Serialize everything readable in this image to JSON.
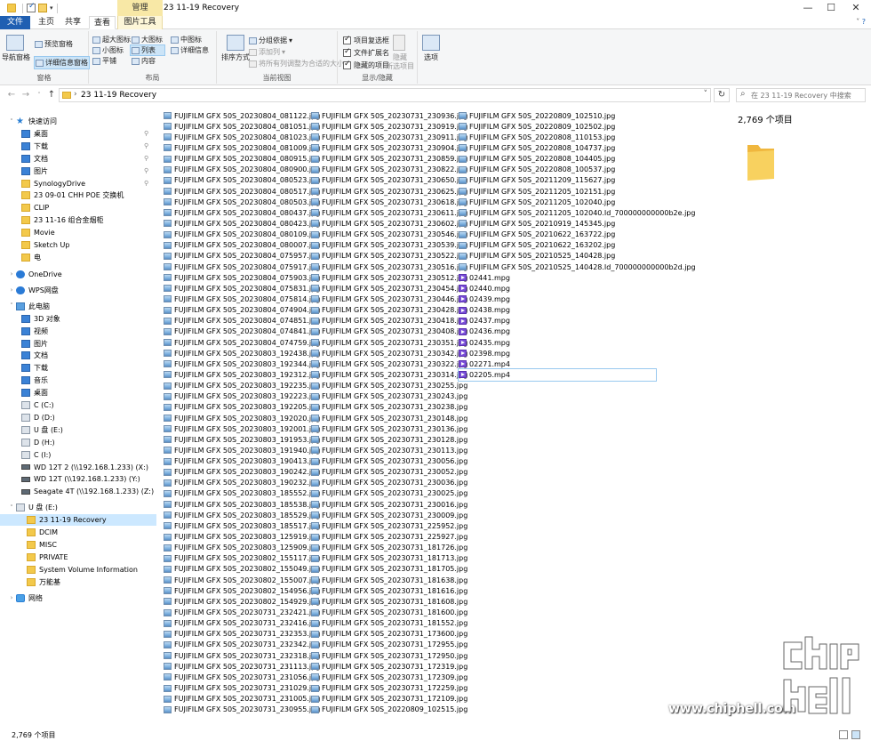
{
  "window": {
    "title": "23 11-19 Recovery",
    "manage_tab": "管理",
    "controls": {
      "minimize": "—",
      "maximize": "☐",
      "close": "✕"
    }
  },
  "tabs": [
    {
      "label": "文件"
    },
    {
      "label": "主页"
    },
    {
      "label": "共享"
    },
    {
      "label": "查看"
    },
    {
      "label": "图片工具"
    }
  ],
  "ribbon": {
    "pane_group": {
      "label": "窗格",
      "nav_pane": "导航窗格",
      "preview_pane": "预览窗格",
      "details_pane": "详细信息窗格"
    },
    "layout_group": {
      "label": "布局",
      "items": [
        "超大图标",
        "大图标",
        "中图标",
        "小图标",
        "列表",
        "详细信息",
        "平铺",
        "内容"
      ]
    },
    "current_view_group": {
      "label": "当前视图",
      "sort": "排序方式",
      "group_by": "分组依据",
      "add_columns": "添加列",
      "fit_columns": "将所有列调整为合适的大小"
    },
    "show_hide_group": {
      "label": "显示/隐藏",
      "item_checkboxes": "项目复选框",
      "file_extensions": "文件扩展名",
      "hidden_items": "隐藏的项目",
      "hide": "隐藏",
      "hide_selected": "所选项目"
    },
    "options": "选项"
  },
  "address": {
    "path": "23 11-19 Recovery",
    "search_placeholder": "在 23 11-19 Recovery 中搜索"
  },
  "nav": {
    "quick_access": "快速访问",
    "items": [
      {
        "label": "桌面",
        "icon": "blue",
        "pin": true
      },
      {
        "label": "下载",
        "icon": "download",
        "pin": true
      },
      {
        "label": "文档",
        "icon": "doc",
        "pin": true
      },
      {
        "label": "图片",
        "icon": "pic",
        "pin": true
      },
      {
        "label": "SynologyDrive",
        "icon": "folder",
        "pin": true
      },
      {
        "label": "23 09-01 CHH POE 交换机",
        "icon": "folder",
        "pin": false
      },
      {
        "label": "CLIP",
        "icon": "folder",
        "pin": false
      },
      {
        "label": "23 11-16 组合金烟柜",
        "icon": "folder",
        "pin": false
      },
      {
        "label": "Movie",
        "icon": "folder",
        "pin": false
      },
      {
        "label": "Sketch Up",
        "icon": "folder",
        "pin": false
      },
      {
        "label": "电",
        "icon": "folder",
        "pin": false
      }
    ],
    "onedrive": "OneDrive",
    "wps": "WPS网盘",
    "this_pc": "此电脑",
    "pc_items": [
      {
        "label": "3D 对象",
        "icon": "blue"
      },
      {
        "label": "视频",
        "icon": "blue"
      },
      {
        "label": "图片",
        "icon": "blue"
      },
      {
        "label": "文档",
        "icon": "blue"
      },
      {
        "label": "下载",
        "icon": "blue"
      },
      {
        "label": "音乐",
        "icon": "blue"
      },
      {
        "label": "桌面",
        "icon": "blue"
      },
      {
        "label": "C (C:)",
        "icon": "drive"
      },
      {
        "label": "D (D:)",
        "icon": "drive"
      },
      {
        "label": "U 盘 (E:)",
        "icon": "drive"
      },
      {
        "label": "D (H:)",
        "icon": "drive"
      },
      {
        "label": "C (I:)",
        "icon": "drive"
      },
      {
        "label": "WD 12T 2 (\\\\192.168.1.233) (X:)",
        "icon": "netdrive"
      },
      {
        "label": "WD 12T (\\\\192.168.1.233) (Y:)",
        "icon": "netdrive"
      },
      {
        "label": "Seagate 4T (\\\\192.168.1.233) (Z:)",
        "icon": "netdrive"
      }
    ],
    "usb": "U 盘 (E:)",
    "usb_items": [
      {
        "label": "23 11-19 Recovery",
        "selected": true
      },
      {
        "label": "DCIM",
        "selected": false
      },
      {
        "label": "MISC",
        "selected": false
      },
      {
        "label": "PRIVATE",
        "selected": false
      },
      {
        "label": "System Volume Information",
        "selected": false
      },
      {
        "label": "万能基",
        "selected": false
      }
    ],
    "network": "网络"
  },
  "files": {
    "col1": [
      "FUJIFILM GFX 50S_20230804_081122.jpg",
      "FUJIFILM GFX 50S_20230804_081051.jpg",
      "FUJIFILM GFX 50S_20230804_081023.jpg",
      "FUJIFILM GFX 50S_20230804_081009.jpg",
      "FUJIFILM GFX 50S_20230804_080915.jpg",
      "FUJIFILM GFX 50S_20230804_080900.jpg",
      "FUJIFILM GFX 50S_20230804_080523.jpg",
      "FUJIFILM GFX 50S_20230804_080517.jpg",
      "FUJIFILM GFX 50S_20230804_080503.jpg",
      "FUJIFILM GFX 50S_20230804_080437.jpg",
      "FUJIFILM GFX 50S_20230804_080423.jpg",
      "FUJIFILM GFX 50S_20230804_080109.jpg",
      "FUJIFILM GFX 50S_20230804_080007.jpg",
      "FUJIFILM GFX 50S_20230804_075957.jpg",
      "FUJIFILM GFX 50S_20230804_075917.jpg",
      "FUJIFILM GFX 50S_20230804_075903.jpg",
      "FUJIFILM GFX 50S_20230804_075831.jpg",
      "FUJIFILM GFX 50S_20230804_075814.jpg",
      "FUJIFILM GFX 50S_20230804_074904.jpg",
      "FUJIFILM GFX 50S_20230804_074851.jpg",
      "FUJIFILM GFX 50S_20230804_074841.jpg",
      "FUJIFILM GFX 50S_20230804_074759.jpg",
      "FUJIFILM GFX 50S_20230803_192438.jpg",
      "FUJIFILM GFX 50S_20230803_192344.jpg",
      "FUJIFILM GFX 50S_20230803_192312.jpg",
      "FUJIFILM GFX 50S_20230803_192235.jpg",
      "FUJIFILM GFX 50S_20230803_192223.jpg",
      "FUJIFILM GFX 50S_20230803_192205.jpg",
      "FUJIFILM GFX 50S_20230803_192020.jpg",
      "FUJIFILM GFX 50S_20230803_192001.jpg",
      "FUJIFILM GFX 50S_20230803_191953.jpg",
      "FUJIFILM GFX 50S_20230803_191940.jpg",
      "FUJIFILM GFX 50S_20230803_190413.jpg",
      "FUJIFILM GFX 50S_20230803_190242.jpg",
      "FUJIFILM GFX 50S_20230803_190232.jpg",
      "FUJIFILM GFX 50S_20230803_185552.jpg",
      "FUJIFILM GFX 50S_20230803_185538.jpg",
      "FUJIFILM GFX 50S_20230803_185529.jpg",
      "FUJIFILM GFX 50S_20230803_185517.jpg",
      "FUJIFILM GFX 50S_20230803_125919.jpg",
      "FUJIFILM GFX 50S_20230803_125909.jpg",
      "FUJIFILM GFX 50S_20230802_155117.jpg",
      "FUJIFILM GFX 50S_20230802_155049.jpg",
      "FUJIFILM GFX 50S_20230802_155007.jpg",
      "FUJIFILM GFX 50S_20230802_154956.jpg",
      "FUJIFILM GFX 50S_20230802_154929.jpg",
      "FUJIFILM GFX 50S_20230731_232421.jpg",
      "FUJIFILM GFX 50S_20230731_232416.jpg",
      "FUJIFILM GFX 50S_20230731_232353.jpg",
      "FUJIFILM GFX 50S_20230731_232342.jpg",
      "FUJIFILM GFX 50S_20230731_232318.jpg",
      "FUJIFILM GFX 50S_20230731_231113.jpg",
      "FUJIFILM GFX 50S_20230731_231056.jpg",
      "FUJIFILM GFX 50S_20230731_231029.jpg",
      "FUJIFILM GFX 50S_20230731_231005.jpg",
      "FUJIFILM GFX 50S_20230731_230955.jpg"
    ],
    "col2": [
      "FUJIFILM GFX 50S_20230731_230936.jpg",
      "FUJIFILM GFX 50S_20230731_230919.jpg",
      "FUJIFILM GFX 50S_20230731_230911.jpg",
      "FUJIFILM GFX 50S_20230731_230904.jpg",
      "FUJIFILM GFX 50S_20230731_230859.jpg",
      "FUJIFILM GFX 50S_20230731_230822.jpg",
      "FUJIFILM GFX 50S_20230731_230650.jpg",
      "FUJIFILM GFX 50S_20230731_230625.jpg",
      "FUJIFILM GFX 50S_20230731_230618.jpg",
      "FUJIFILM GFX 50S_20230731_230611.jpg",
      "FUJIFILM GFX 50S_20230731_230602.jpg",
      "FUJIFILM GFX 50S_20230731_230546.jpg",
      "FUJIFILM GFX 50S_20230731_230539.jpg",
      "FUJIFILM GFX 50S_20230731_230522.jpg",
      "FUJIFILM GFX 50S_20230731_230516.jpg",
      "FUJIFILM GFX 50S_20230731_230512.jpg",
      "FUJIFILM GFX 50S_20230731_230454.jpg",
      "FUJIFILM GFX 50S_20230731_230446.jpg",
      "FUJIFILM GFX 50S_20230731_230428.jpg",
      "FUJIFILM GFX 50S_20230731_230418.jpg",
      "FUJIFILM GFX 50S_20230731_230408.jpg",
      "FUJIFILM GFX 50S_20230731_230351.jpg",
      "FUJIFILM GFX 50S_20230731_230342.jpg",
      "FUJIFILM GFX 50S_20230731_230322.jpg",
      "FUJIFILM GFX 50S_20230731_230314.jpg",
      "FUJIFILM GFX 50S_20230731_230255.jpg",
      "FUJIFILM GFX 50S_20230731_230243.jpg",
      "FUJIFILM GFX 50S_20230731_230238.jpg",
      "FUJIFILM GFX 50S_20230731_230148.jpg",
      "FUJIFILM GFX 50S_20230731_230136.jpg",
      "FUJIFILM GFX 50S_20230731_230128.jpg",
      "FUJIFILM GFX 50S_20230731_230113.jpg",
      "FUJIFILM GFX 50S_20230731_230056.jpg",
      "FUJIFILM GFX 50S_20230731_230052.jpg",
      "FUJIFILM GFX 50S_20230731_230036.jpg",
      "FUJIFILM GFX 50S_20230731_230025.jpg",
      "FUJIFILM GFX 50S_20230731_230016.jpg",
      "FUJIFILM GFX 50S_20230731_230009.jpg",
      "FUJIFILM GFX 50S_20230731_225952.jpg",
      "FUJIFILM GFX 50S_20230731_225927.jpg",
      "FUJIFILM GFX 50S_20230731_181726.jpg",
      "FUJIFILM GFX 50S_20230731_181713.jpg",
      "FUJIFILM GFX 50S_20230731_181705.jpg",
      "FUJIFILM GFX 50S_20230731_181638.jpg",
      "FUJIFILM GFX 50S_20230731_181616.jpg",
      "FUJIFILM GFX 50S_20230731_181608.jpg",
      "FUJIFILM GFX 50S_20230731_181600.jpg",
      "FUJIFILM GFX 50S_20230731_181552.jpg",
      "FUJIFILM GFX 50S_20230731_173600.jpg",
      "FUJIFILM GFX 50S_20230731_172955.jpg",
      "FUJIFILM GFX 50S_20230731_172950.jpg",
      "FUJIFILM GFX 50S_20230731_172319.jpg",
      "FUJIFILM GFX 50S_20230731_172309.jpg",
      "FUJIFILM GFX 50S_20230731_172259.jpg",
      "FUJIFILM GFX 50S_20230731_172109.jpg",
      "FUJIFILM GFX 50S_20220809_102515.jpg"
    ],
    "col3": [
      {
        "name": "FUJIFILM GFX 50S_20220809_102510.jpg",
        "type": "img"
      },
      {
        "name": "FUJIFILM GFX 50S_20220809_102502.jpg",
        "type": "img"
      },
      {
        "name": "FUJIFILM GFX 50S_20220808_110153.jpg",
        "type": "img"
      },
      {
        "name": "FUJIFILM GFX 50S_20220808_104737.jpg",
        "type": "img"
      },
      {
        "name": "FUJIFILM GFX 50S_20220808_104405.jpg",
        "type": "img"
      },
      {
        "name": "FUJIFILM GFX 50S_20220808_100537.jpg",
        "type": "img"
      },
      {
        "name": "FUJIFILM GFX 50S_20211209_115627.jpg",
        "type": "img"
      },
      {
        "name": "FUJIFILM GFX 50S_20211205_102151.jpg",
        "type": "img"
      },
      {
        "name": "FUJIFILM GFX 50S_20211205_102040.jpg",
        "type": "img"
      },
      {
        "name": "FUJIFILM GFX 50S_20211205_102040.Id_700000000000b2e.jpg",
        "type": "img"
      },
      {
        "name": "FUJIFILM GFX 50S_20210919_145345.jpg",
        "type": "img"
      },
      {
        "name": "FUJIFILM GFX 50S_20210622_163722.jpg",
        "type": "img"
      },
      {
        "name": "FUJIFILM GFX 50S_20210622_163202.jpg",
        "type": "img"
      },
      {
        "name": "FUJIFILM GFX 50S_20210525_140428.jpg",
        "type": "img"
      },
      {
        "name": "FUJIFILM GFX 50S_20210525_140428.Id_700000000000b2d.jpg",
        "type": "img"
      },
      {
        "name": "02441.mpg",
        "type": "vid"
      },
      {
        "name": "02440.mpg",
        "type": "vid"
      },
      {
        "name": "02439.mpg",
        "type": "vid"
      },
      {
        "name": "02438.mpg",
        "type": "vid"
      },
      {
        "name": "02437.mpg",
        "type": "vid"
      },
      {
        "name": "02436.mpg",
        "type": "vid"
      },
      {
        "name": "02435.mpg",
        "type": "vid"
      },
      {
        "name": "02398.mpg",
        "type": "vid"
      },
      {
        "name": "02271.mp4",
        "type": "vid"
      },
      {
        "name": "02205.mp4",
        "type": "vid",
        "focus": true
      }
    ]
  },
  "details": {
    "count": "2,769 个项目"
  },
  "status": {
    "count": "2,769 个项目"
  },
  "watermark": {
    "url": "www.chiphell.com",
    "logo_text": "chip hell"
  }
}
